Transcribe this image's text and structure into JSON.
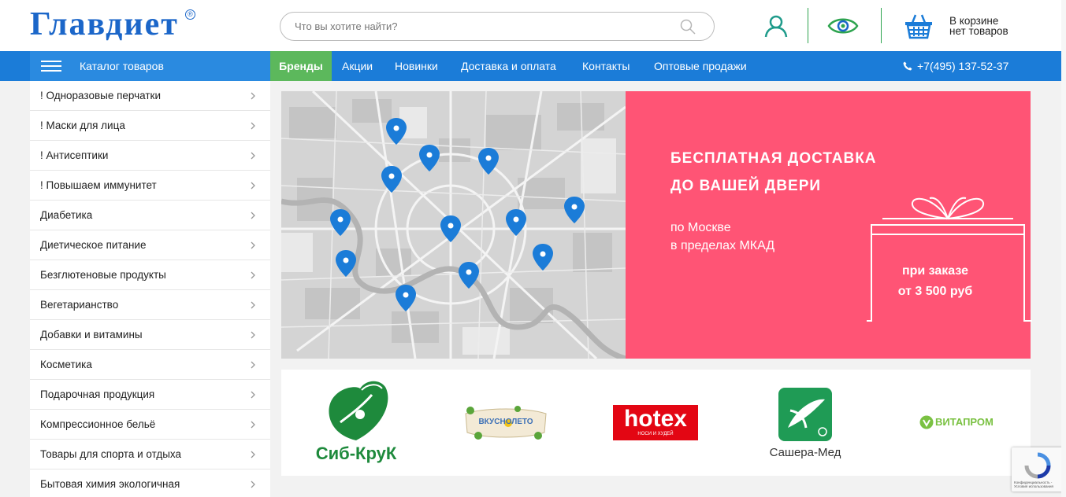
{
  "header": {
    "logo_text": "Главдиет",
    "logo_mark": "®",
    "search_placeholder": "Что вы хотите найти?",
    "cart_line1": "В корзине",
    "cart_line2": "нет товаров"
  },
  "nav": {
    "catalog_label": "Каталог товаров",
    "items": [
      "Бренды",
      "Акции",
      "Новинки",
      "Доставка и оплата",
      "Контакты",
      "Оптовые продажи"
    ],
    "phone": "+7(495) 137-52-37"
  },
  "sidebar": {
    "items": [
      "! Одноразовые перчатки",
      "! Маски для лица",
      "! Антисептики",
      "! Повышаем иммунитет",
      "Диабетика",
      "Диетическое питание",
      "Безглютеновые продукты",
      "Вегетарианство",
      "Добавки и витамины",
      "Косметика",
      "Подарочная продукция",
      "Компрессионное бельё",
      "Товары для спорта и отдыха",
      "Бытовая химия экологичная"
    ]
  },
  "banner": {
    "title_line1": "БЕСПЛАТНАЯ ДОСТАВКА",
    "title_line2": "ДО ВАШЕЙ ДВЕРИ",
    "sub_line1": "по Москве",
    "sub_line2": "в пределах МКАД",
    "gift_line1": "при заказе",
    "gift_line2": "от 3 500 руб"
  },
  "brands": {
    "sibkruk": "Сиб-КруК",
    "vkusnoleto": "ВКУСНОЛЕТО",
    "hotex": "hotex",
    "hotex_sub": "НОСИ И ХУДЕЙ",
    "sashera": "Сашера-Мед",
    "vitaprom": "ВИТАПРОМ"
  },
  "recaptcha": {
    "line1": "Конфиденциальность -",
    "line2": "Условия использования"
  },
  "colors": {
    "brand_blue": "#1b66c9",
    "nav_blue": "#1b7cd8",
    "green": "#5cb85c",
    "promo_pink": "#ff5475"
  }
}
